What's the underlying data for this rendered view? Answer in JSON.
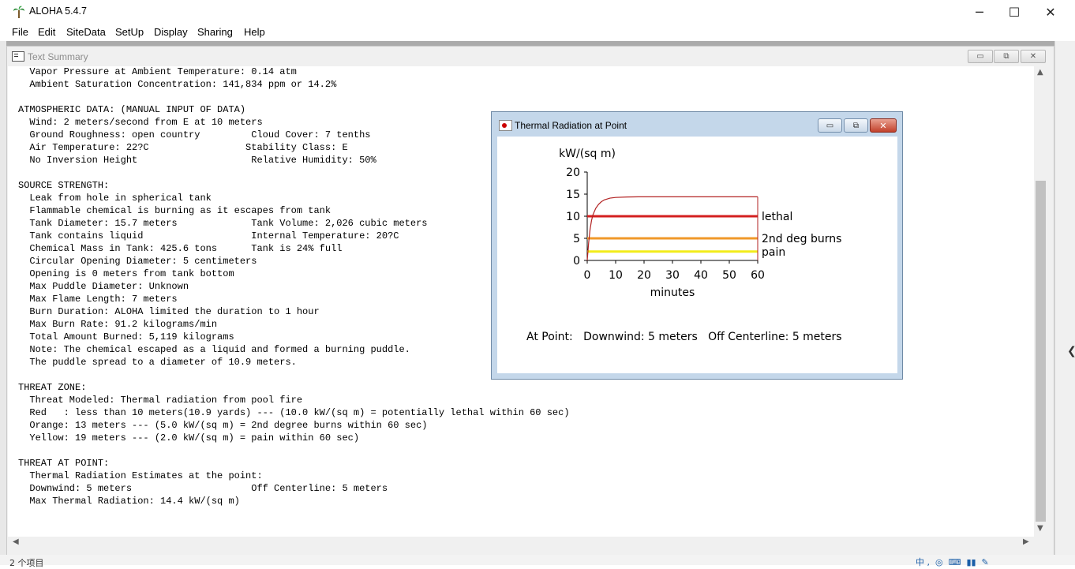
{
  "app": {
    "title": "ALOHA 5.4.7"
  },
  "window_controls": {
    "minimize": "─",
    "maximize": "☐",
    "close": "✕"
  },
  "menu": [
    "File",
    "Edit",
    "SiteData",
    "SetUp",
    "Display",
    "Sharing",
    "Help"
  ],
  "text_summary": {
    "title": "Text Summary",
    "lines": [
      "  Vapor Pressure at Ambient Temperature: 0.14 atm",
      "  Ambient Saturation Concentration: 141,834 ppm or 14.2%",
      "",
      "ATMOSPHERIC DATA: (MANUAL INPUT OF DATA)",
      "  Wind: 2 meters/second from E at 10 meters",
      "  Ground Roughness: open country         Cloud Cover: 7 tenths",
      "  Air Temperature: 22?C                 Stability Class: E",
      "  No Inversion Height                    Relative Humidity: 50%",
      "",
      "SOURCE STRENGTH:",
      "  Leak from hole in spherical tank",
      "  Flammable chemical is burning as it escapes from tank",
      "  Tank Diameter: 15.7 meters             Tank Volume: 2,026 cubic meters",
      "  Tank contains liquid                   Internal Temperature: 20?C",
      "  Chemical Mass in Tank: 425.6 tons      Tank is 24% full",
      "  Circular Opening Diameter: 5 centimeters",
      "  Opening is 0 meters from tank bottom",
      "  Max Puddle Diameter: Unknown",
      "  Max Flame Length: 7 meters",
      "  Burn Duration: ALOHA limited the duration to 1 hour",
      "  Max Burn Rate: 91.2 kilograms/min",
      "  Total Amount Burned: 5,119 kilograms",
      "  Note: The chemical escaped as a liquid and formed a burning puddle.",
      "  The puddle spread to a diameter of 10.9 meters.",
      "",
      "THREAT ZONE:",
      "  Threat Modeled: Thermal radiation from pool fire",
      "  Red   : less than 10 meters(10.9 yards) --- (10.0 kW/(sq m) = potentially lethal within 60 sec)",
      "  Orange: 13 meters --- (5.0 kW/(sq m) = 2nd degree burns within 60 sec)",
      "  Yellow: 19 meters --- (2.0 kW/(sq m) = pain within 60 sec)",
      "",
      "THREAT AT POINT:",
      "  Thermal Radiation Estimates at the point:",
      "  Downwind: 5 meters                     Off Centerline: 5 meters",
      "  Max Thermal Radiation: 14.4 kW/(sq m)"
    ]
  },
  "thermal_window": {
    "title": "Thermal Radiation at Point",
    "point_info": "At Point:   Downwind: 5 meters   Off Centerline: 5 meters"
  },
  "chart_data": {
    "type": "line",
    "ylabel": "kW/(sq m)",
    "xlabel": "minutes",
    "xlim": [
      0,
      60
    ],
    "ylim": [
      0,
      20
    ],
    "x_ticks": [
      0,
      10,
      20,
      30,
      40,
      50,
      60
    ],
    "y_ticks": [
      0,
      5,
      10,
      15,
      20
    ],
    "series": [
      {
        "color": "#b22222",
        "x": [
          0,
          0.5,
          1,
          1.5,
          2,
          3,
          4,
          5,
          6,
          8,
          10,
          14,
          18,
          22,
          30,
          40,
          50,
          60
        ],
        "y": [
          0,
          4,
          7,
          9,
          10.3,
          11.8,
          12.7,
          13.3,
          13.7,
          14.1,
          14.25,
          14.35,
          14.4,
          14.4,
          14.4,
          14.4,
          14.4,
          14.4
        ]
      }
    ],
    "thresholds": [
      {
        "name": "lethal",
        "value": 10,
        "color": "#d42020"
      },
      {
        "name": "2nd deg burns",
        "value": 5,
        "color": "#f0982a"
      },
      {
        "name": "pain",
        "value": 2,
        "color": "#f2ec1a"
      }
    ]
  },
  "taskbar": {
    "status": "2 个项目",
    "tray": "中 ,  ◎  ⌨  ▮▮  ✎"
  }
}
